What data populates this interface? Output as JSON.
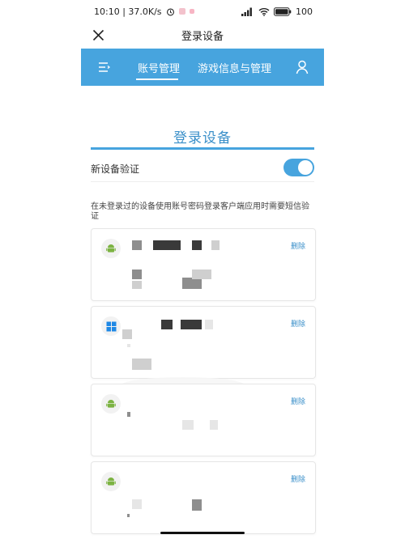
{
  "status_bar": {
    "time_speed": "10:10 | 37.0K/s",
    "battery": "100"
  },
  "nav": {
    "title": "登录设备"
  },
  "tabs": [
    {
      "label": "账号管理",
      "active": true
    },
    {
      "label": "游戏信息与管理",
      "active": false
    }
  ],
  "section": {
    "title": "登录设备",
    "toggle_label": "新设备验证",
    "toggle_on": true,
    "description": "在未登录过的设备使用账号密码登录客户端应用时需要短信验证"
  },
  "devices": [
    {
      "os_icon": "android-icon",
      "delete_label": "删除"
    },
    {
      "os_icon": "windows-icon",
      "delete_label": "删除"
    },
    {
      "os_icon": "android-icon",
      "delete_label": "删除"
    },
    {
      "os_icon": "android-icon",
      "delete_label": "删除"
    }
  ],
  "colors": {
    "accent": "#47a4de",
    "title_blue": "#3a8fc9",
    "android_green": "#7cb342",
    "windows_blue": "#1e88e5"
  }
}
